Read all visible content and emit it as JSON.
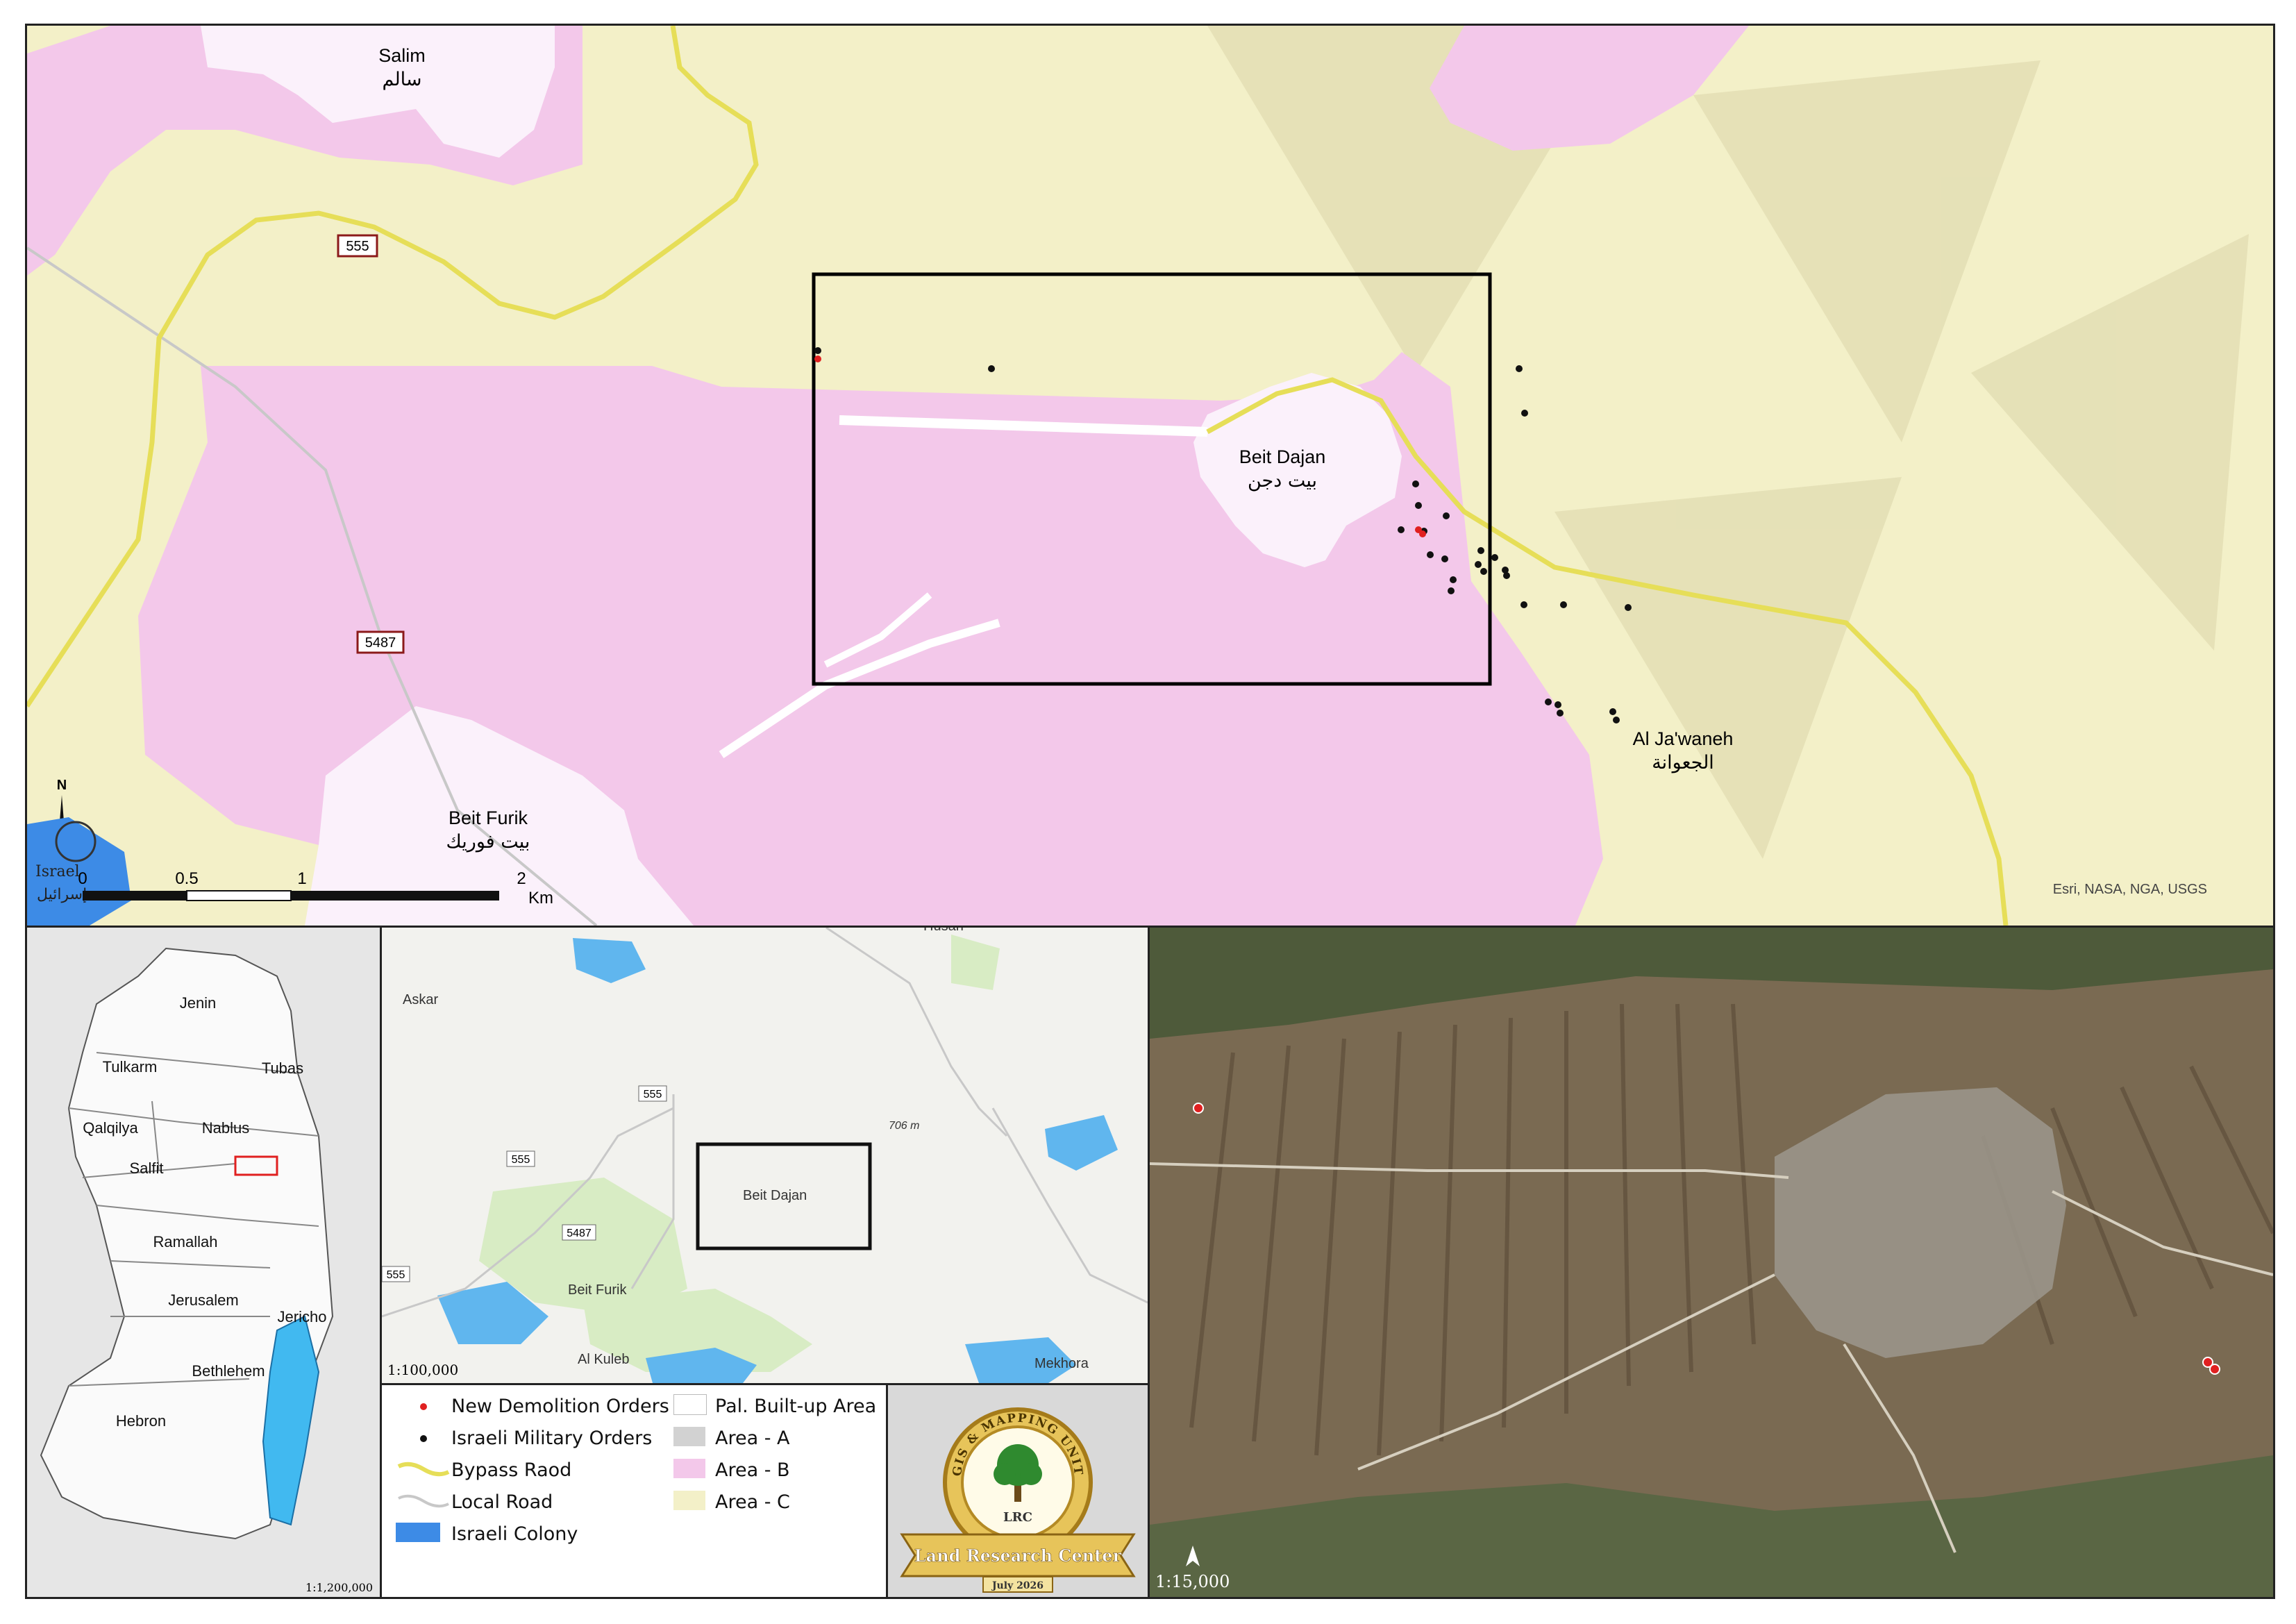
{
  "main_map": {
    "places": [
      {
        "en": "Salim",
        "ar": "سالم"
      },
      {
        "en": "Beit Dajan",
        "ar": "بيت دجن"
      },
      {
        "en": "Al Ja'waneh",
        "ar": "الجعوانة"
      },
      {
        "en": "Beit Furik",
        "ar": "بيت فوريك"
      }
    ],
    "road_shields": [
      "555",
      "5487"
    ],
    "scale_bar": {
      "ticks": [
        "0",
        "0.5",
        "1",
        "2"
      ],
      "unit": "Km"
    },
    "north_label": "N",
    "attribution": "Esri, NASA, NGA, USGS",
    "logo_text_en": "Israel",
    "logo_text_ar": "إسرائيل"
  },
  "west_bank_inset": {
    "regions": [
      "Jenin",
      "Tulkarm",
      "Tubas",
      "Qalqilya",
      "Nablus",
      "Salfit",
      "Ramallah",
      "Jerusalem",
      "Jericho",
      "Bethlehem",
      "Hebron"
    ],
    "scale": "1:1,200,000"
  },
  "regional_inset": {
    "labels": [
      "Askar",
      "Beit Dajan",
      "Beit Furik",
      "Al Kuleb",
      "Mekhora",
      "Husan",
      "706 m"
    ],
    "road_shields": [
      "555",
      "555",
      "5487",
      "555"
    ],
    "scale": "1:100,000"
  },
  "aerial_inset": {
    "scale": "1:15,000"
  },
  "legend": {
    "items": [
      {
        "label": "New Demolition Orders",
        "symbol": "red-dot",
        "color": "#e02020"
      },
      {
        "label": "Israeli Military Orders",
        "symbol": "black-dot",
        "color": "#111111"
      },
      {
        "label": "Bypass Raod",
        "symbol": "yellow-line",
        "color": "#e8e060"
      },
      {
        "label": "Local Road",
        "symbol": "grey-line",
        "color": "#c8c8c8"
      },
      {
        "label": "Israeli Colony",
        "symbol": "blue-box",
        "color": "#3d8be6"
      },
      {
        "label": "Pal. Built-up Area",
        "symbol": "white-box",
        "color": "#ffffff"
      },
      {
        "label": "Area - A",
        "symbol": "grey-box",
        "color": "#d2d2d2"
      },
      {
        "label": "Area - B",
        "symbol": "pink-box",
        "color": "#f3c8ea"
      },
      {
        "label": "Area - C",
        "symbol": "yellow-box",
        "color": "#f3f0c8"
      }
    ]
  },
  "seal": {
    "top_text": "GIS & MAPPING UNIT",
    "abbrev": "LRC",
    "name": "Land Research Center",
    "date": "July 2026"
  }
}
